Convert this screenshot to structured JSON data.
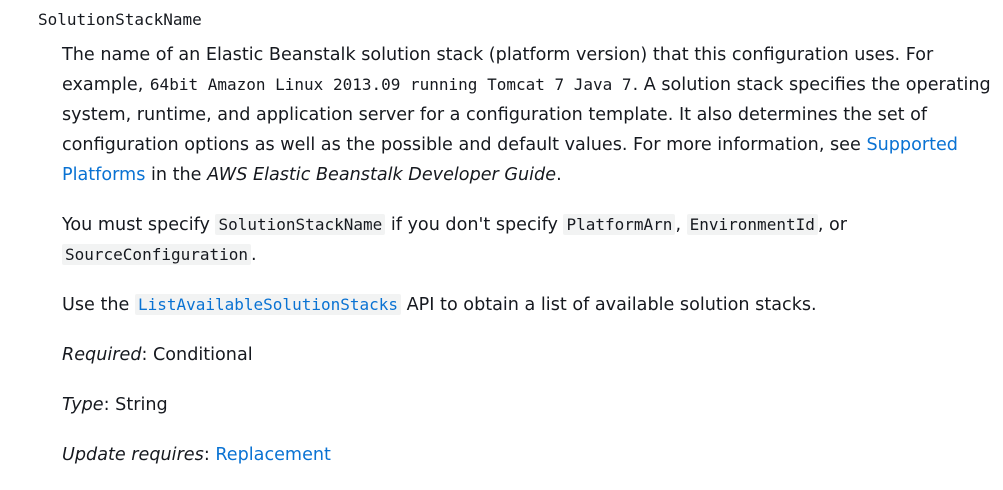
{
  "term": "SolutionStackName",
  "description": {
    "p1_a": "The name of an Elastic Beanstalk solution stack (platform version) that this configuration uses. For example, ",
    "p1_code": "64bit Amazon Linux 2013.09 running Tomcat 7 Java 7",
    "p1_b": ". A solution stack specifies the operating system, runtime, and application server for a configuration template. It also determines the set of configuration options as well as the possible and default values. For more information, see ",
    "p1_link": "Supported Platforms",
    "p1_c": " in the ",
    "p1_guide": "AWS Elastic Beanstalk Developer Guide",
    "p1_d": ".",
    "p2_a": "You must specify ",
    "p2_code1": "SolutionStackName",
    "p2_b": " if you don't specify ",
    "p2_code2": "PlatformArn",
    "p2_c": ", ",
    "p2_code3": "EnvironmentId",
    "p2_d": ", or ",
    "p2_code4": "SourceConfiguration",
    "p2_e": ".",
    "p3_a": "Use the ",
    "p3_link": "ListAvailableSolutionStacks",
    "p3_b": " API to obtain a list of available solution stacks."
  },
  "properties": {
    "required_label": "Required",
    "required_value": ": Conditional",
    "type_label": "Type",
    "type_value": ": String",
    "update_label": "Update requires",
    "update_sep": ": ",
    "update_link": "Replacement"
  },
  "colors": {
    "text": "#16191f",
    "link": "#0972d3",
    "code_bg": "#f2f3f3"
  }
}
